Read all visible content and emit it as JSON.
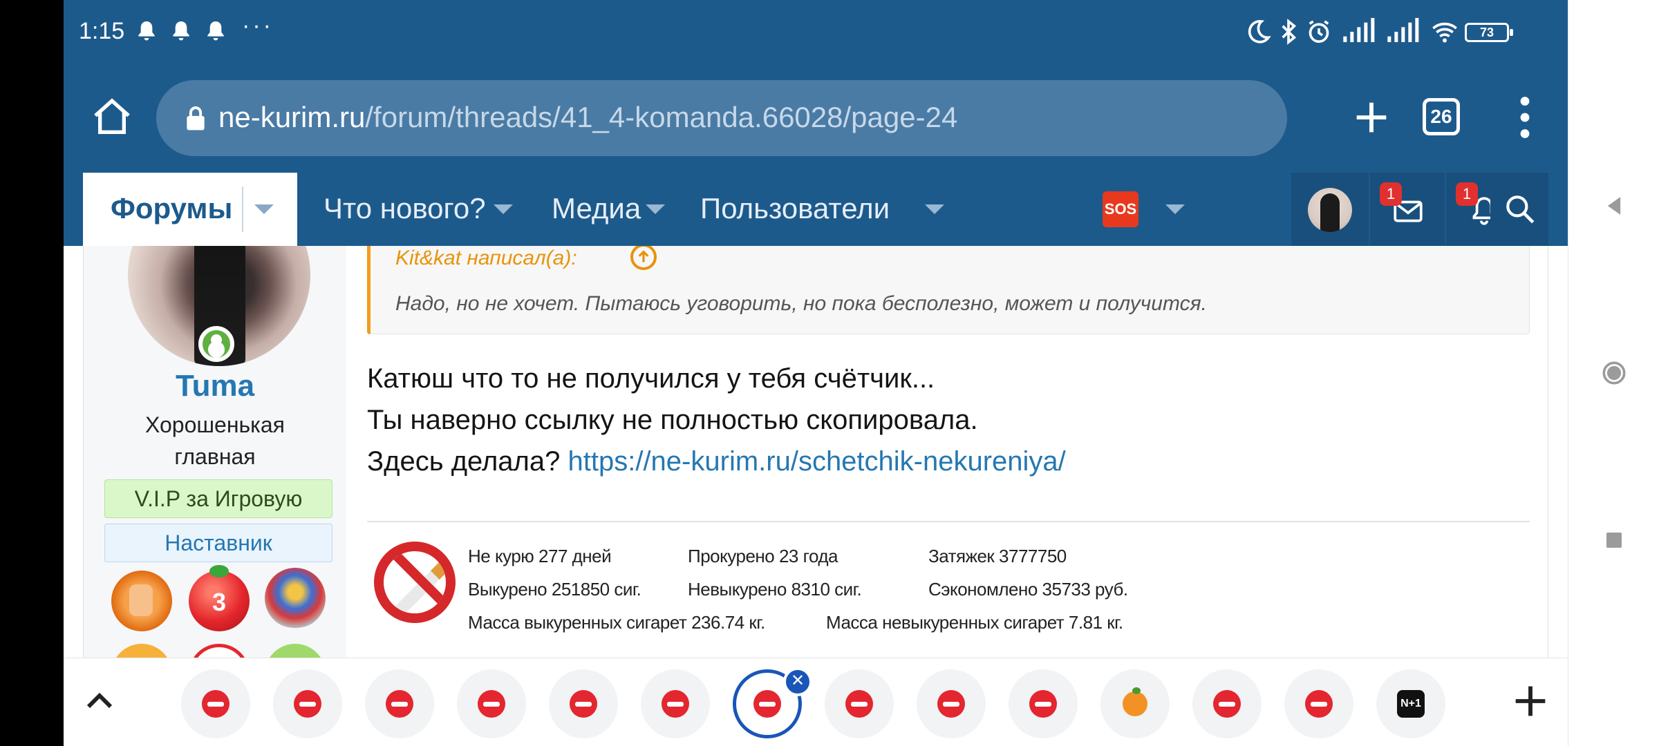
{
  "status_bar": {
    "time": "1:15",
    "overflow": "···",
    "battery": "73",
    "icons": [
      "notification-bell-icon",
      "notification-bell-icon",
      "notification-bell-icon",
      "moon-icon",
      "bluetooth-icon",
      "alarm-icon",
      "signal-icon",
      "signal-icon",
      "wifi-icon",
      "battery-icon"
    ]
  },
  "browser": {
    "url_host": "ne-kurim.ru",
    "url_path": "/forum/threads/41_4-komanda.66028/page-24",
    "tab_count": "26"
  },
  "forum_nav": {
    "tabs": [
      {
        "label": "Форумы"
      },
      {
        "label": "Что нового?"
      },
      {
        "label": "Медиа"
      },
      {
        "label": "Пользователи"
      },
      {
        "label": "SOS"
      }
    ],
    "inbox_badge": "1",
    "alerts_badge": "1"
  },
  "user": {
    "name": "Tuma",
    "title": "Хорошенькая главная",
    "banners": [
      "V.I.P за Игровую",
      "Наставник"
    ],
    "trophy_tomato_number": "3"
  },
  "post": {
    "quote_author": "Kit&kat написал(а):",
    "quote_text": "Надо, но не хочет. Пытаюсь уговорить, но пока бесполезно, может и получится.",
    "lines": [
      "Катюш что то не получился у тебя счётчик...",
      "Ты наверно ссылку не полностью скопировала.",
      "Здесь делала? "
    ],
    "link": "https://ne-kurim.ru/schetchik-nekureniya/",
    "counter": {
      "days": "Не курю 277 дней",
      "smoked_years": "Прокурено 23 года",
      "puffs": "Затяжек 3777750",
      "smoked_cigs": "Выкурено 251850 сиг.",
      "not_smoked_cigs": "Невыкурено 8310 сиг.",
      "saved": "Сэкономлено 35733 руб.",
      "mass_smoked": "Масса выкуренных сигарет 236.74 кг.",
      "mass_not_smoked": "Масса невыкуренных сигарет 7.81 кг."
    }
  },
  "tab_strip": {
    "close_symbol": "✕",
    "n1_label": "N+1"
  },
  "colors": {
    "header_blue": "#1d5a8c",
    "link_blue": "#2577b1",
    "quote_orange": "#f39b1c",
    "badge_red": "#e0302f"
  }
}
